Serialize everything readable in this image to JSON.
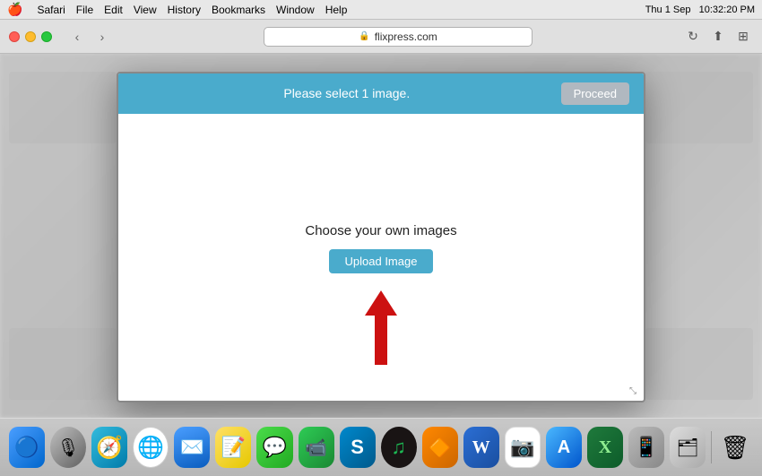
{
  "menubar": {
    "apple": "🍎",
    "app_name": "Safari",
    "menus": [
      "Safari",
      "File",
      "Edit",
      "View",
      "History",
      "Bookmarks",
      "Window",
      "Help"
    ],
    "right_items": [
      "Thu 1 Sep",
      "10:32:20 PM"
    ]
  },
  "browser": {
    "address": "flixpress.com",
    "nav": {
      "back": "‹",
      "forward": "›"
    }
  },
  "modal": {
    "header_text": "Please select 1 image.",
    "proceed_label": "Proceed",
    "choose_label": "Choose your own images",
    "upload_label": "Upload Image"
  },
  "dock": {
    "items": [
      {
        "name": "finder",
        "icon": "🔵",
        "label": "Finder"
      },
      {
        "name": "siri",
        "icon": "🎙",
        "label": "Siri"
      },
      {
        "name": "safari",
        "icon": "🧭",
        "label": "Safari"
      },
      {
        "name": "chrome",
        "icon": "🌐",
        "label": "Chrome"
      },
      {
        "name": "mail",
        "icon": "✉️",
        "label": "Mail"
      },
      {
        "name": "notes",
        "icon": "📝",
        "label": "Notes"
      },
      {
        "name": "messages",
        "icon": "💬",
        "label": "Messages"
      },
      {
        "name": "facetime",
        "icon": "📹",
        "label": "FaceTime"
      },
      {
        "name": "skype",
        "icon": "📞",
        "label": "Skype"
      },
      {
        "name": "spotify",
        "icon": "🎵",
        "label": "Spotify"
      },
      {
        "name": "vlc",
        "icon": "🔶",
        "label": "VLC"
      },
      {
        "name": "word",
        "icon": "W",
        "label": "Word"
      },
      {
        "name": "misc1",
        "icon": "📷",
        "label": "Photos"
      },
      {
        "name": "appstore",
        "icon": "A",
        "label": "App Store"
      },
      {
        "name": "excel",
        "icon": "X",
        "label": "Excel"
      },
      {
        "name": "misc2",
        "icon": "📱",
        "label": "iPhone"
      },
      {
        "name": "misc3",
        "icon": "🗂",
        "label": "Files"
      },
      {
        "name": "trash",
        "icon": "🗑",
        "label": "Trash"
      }
    ]
  },
  "colors": {
    "header_bg": "#4aabcc",
    "upload_btn_bg": "#4aabcc",
    "proceed_btn_bg": "#b0b8c0",
    "arrow_color": "#cc1111"
  }
}
